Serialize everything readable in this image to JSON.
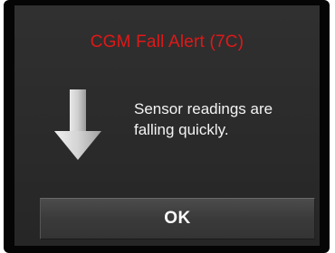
{
  "dialog": {
    "title": "CGM Fall Alert (7C)",
    "message_line1": "Sensor readings are",
    "message_line2": "falling quickly.",
    "ok_label": "OK",
    "icon": "down-arrow-icon"
  },
  "colors": {
    "title": "#e01818",
    "text": "#f4f4f4",
    "screen_bg": "#2a2a2a",
    "bezel": "#050505"
  }
}
